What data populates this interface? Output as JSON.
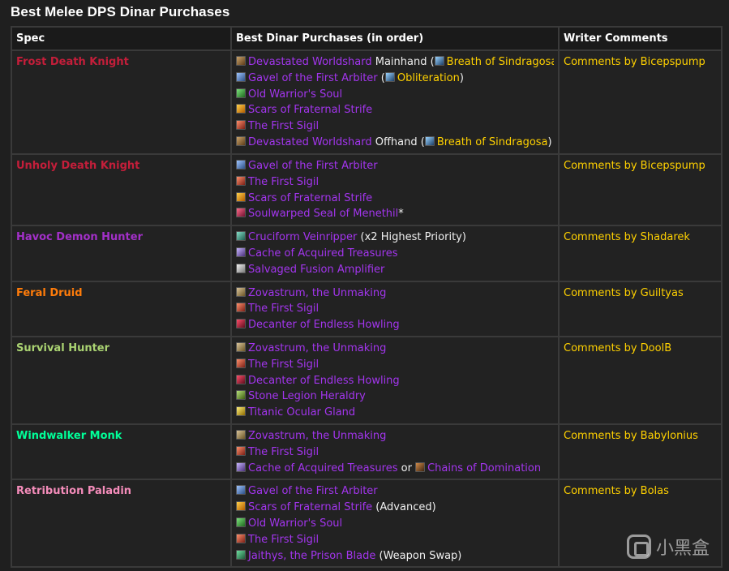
{
  "title": "Best Melee DPS Dinar Purchases",
  "colors": {
    "epic_item": "#a335ee",
    "comment": "#ffd100",
    "dk": "#c41e3a",
    "dh": "#a330c9",
    "druid": "#ff7c0a",
    "hunter": "#aad372",
    "monk": "#00ff98",
    "paladin": "#f48cba"
  },
  "table": {
    "headers": [
      "Spec",
      "Best Dinar Purchases (in order)",
      "Writer Comments"
    ],
    "rows": [
      {
        "spec": "Frost Death Knight",
        "comment": "Comments by Bicepspump",
        "lines": [
          {
            "icon": "sword-icon",
            "item": "Devastated Worldshard",
            "after": " Mainhand (",
            "spell_icon": "spell-icon",
            "spell": "Breath of Sindragosa",
            "close": ")"
          },
          {
            "icon": "gavel-icon",
            "item": "Gavel of the First Arbiter",
            "after": " (",
            "spell_icon": "spell-icon",
            "spell": "Obliteration",
            "close": ")"
          },
          {
            "icon": "soul-icon",
            "item": "Old Warrior's Soul"
          },
          {
            "icon": "scars-icon",
            "item": "Scars of Fraternal Strife"
          },
          {
            "icon": "sigil-icon",
            "item": "The First Sigil"
          },
          {
            "icon": "sword-icon",
            "item": "Devastated Worldshard",
            "after": " Offhand (",
            "spell_icon": "spell-icon",
            "spell": "Breath of Sindragosa",
            "close": ")"
          }
        ]
      },
      {
        "spec": "Unholy Death Knight",
        "comment": "Comments by Bicepspump",
        "lines": [
          {
            "icon": "gavel-icon",
            "item": "Gavel of the First Arbiter"
          },
          {
            "icon": "sigil-icon",
            "item": "The First Sigil"
          },
          {
            "icon": "scars-icon",
            "item": "Scars of Fraternal Strife"
          },
          {
            "icon": "seal-icon",
            "item": "Soulwarped Seal of Menethil",
            "after": "*"
          }
        ]
      },
      {
        "spec": "Havoc Demon Hunter",
        "comment": "Comments by Shadarek",
        "lines": [
          {
            "icon": "vein-icon",
            "item": "Cruciform Veinripper",
            "after": " (x2 Highest Priority)"
          },
          {
            "icon": "cache-icon",
            "item": "Cache of Acquired Treasures"
          },
          {
            "icon": "amplifier-icon",
            "item": "Salvaged Fusion Amplifier"
          }
        ]
      },
      {
        "spec": "Feral Druid",
        "comment": "Comments by Guiltyas",
        "lines": [
          {
            "icon": "zovastrum-icon",
            "item": "Zovastrum, the Unmaking"
          },
          {
            "icon": "sigil-icon",
            "item": "The First Sigil"
          },
          {
            "icon": "decanter-icon",
            "item": "Decanter of Endless Howling"
          }
        ]
      },
      {
        "spec": "Survival Hunter",
        "comment": "Comments by DoolB",
        "lines": [
          {
            "icon": "zovastrum-icon",
            "item": "Zovastrum, the Unmaking"
          },
          {
            "icon": "sigil-icon",
            "item": "The First Sigil"
          },
          {
            "icon": "decanter-icon",
            "item": "Decanter of Endless Howling"
          },
          {
            "icon": "heraldry-icon",
            "item": "Stone Legion Heraldry"
          },
          {
            "icon": "gland-icon",
            "item": "Titanic Ocular Gland"
          }
        ]
      },
      {
        "spec": "Windwalker Monk",
        "comment": "Comments by Babylonius",
        "lines": [
          {
            "icon": "zovastrum-icon",
            "item": "Zovastrum, the Unmaking"
          },
          {
            "icon": "sigil-icon",
            "item": "The First Sigil"
          },
          {
            "icon": "cache-icon",
            "item": "Cache of Acquired Treasures",
            "after": " or ",
            "item2_icon": "chains-icon",
            "item2": "Chains of Domination"
          }
        ]
      },
      {
        "spec": "Retribution Paladin",
        "comment": "Comments by Bolas",
        "lines": [
          {
            "icon": "gavel-icon",
            "item": "Gavel of the First Arbiter"
          },
          {
            "icon": "scars-icon",
            "item": "Scars of Fraternal Strife",
            "after": " (Advanced)"
          },
          {
            "icon": "soul-icon",
            "item": "Old Warrior's Soul"
          },
          {
            "icon": "sigil-icon",
            "item": "The First Sigil"
          },
          {
            "icon": "jaithys-icon",
            "item": "Jaithys, the Prison Blade",
            "after": " (Weapon Swap)"
          }
        ]
      }
    ]
  },
  "watermark": {
    "text": "小黑盒"
  }
}
